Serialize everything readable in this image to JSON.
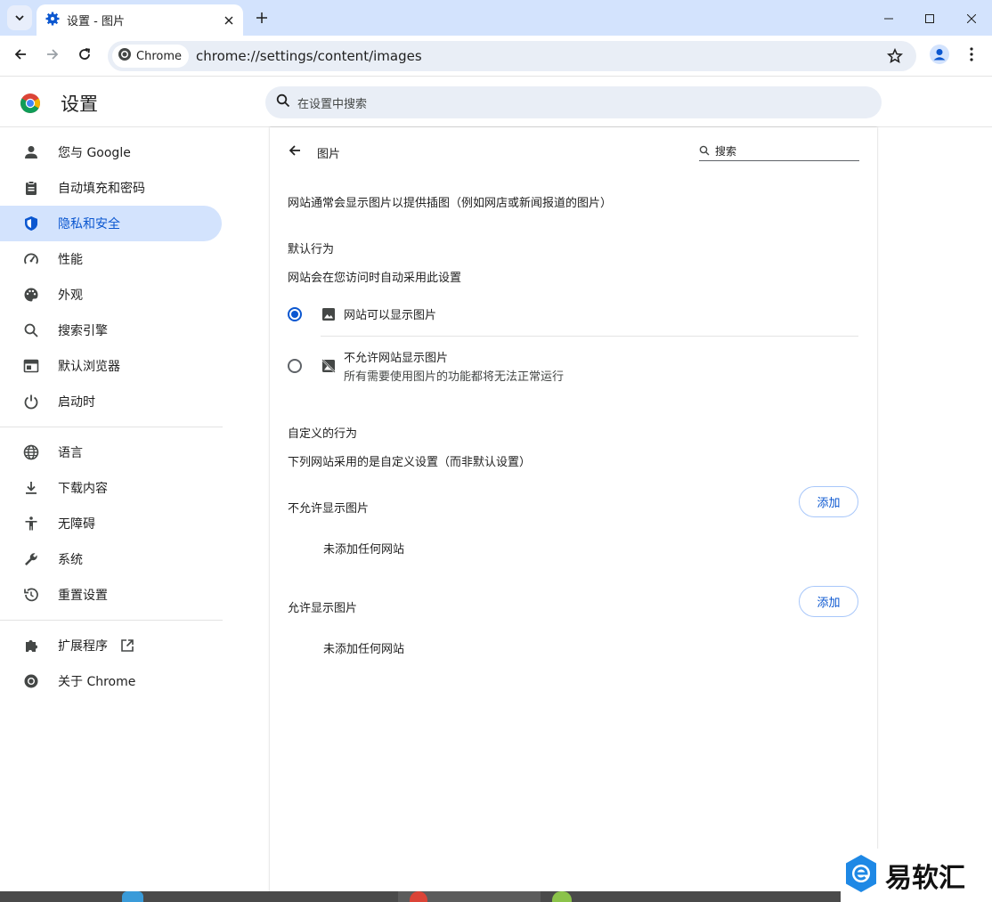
{
  "tab": {
    "title": "设置 - 图片"
  },
  "omnibox": {
    "chip_label": "Chrome",
    "url": "chrome://settings/content/images"
  },
  "header": {
    "title": "设置",
    "search_placeholder": "在设置中搜索"
  },
  "sidebar": {
    "items": [
      {
        "label": "您与 Google",
        "icon": "person-icon"
      },
      {
        "label": "自动填充和密码",
        "icon": "clipboard-icon"
      },
      {
        "label": "隐私和安全",
        "icon": "shield-icon",
        "active": true
      },
      {
        "label": "性能",
        "icon": "speedometer-icon"
      },
      {
        "label": "外观",
        "icon": "palette-icon"
      },
      {
        "label": "搜索引擎",
        "icon": "search-icon"
      },
      {
        "label": "默认浏览器",
        "icon": "browser-icon"
      },
      {
        "label": "启动时",
        "icon": "power-icon"
      },
      {
        "label": "语言",
        "icon": "globe-icon"
      },
      {
        "label": "下载内容",
        "icon": "download-icon"
      },
      {
        "label": "无障碍",
        "icon": "accessibility-icon"
      },
      {
        "label": "系统",
        "icon": "wrench-icon"
      },
      {
        "label": "重置设置",
        "icon": "reset-icon"
      },
      {
        "label": "扩展程序",
        "icon": "puzzle-icon"
      },
      {
        "label": "关于 Chrome",
        "icon": "chrome-icon"
      }
    ]
  },
  "page": {
    "title": "图片",
    "search_placeholder": "搜索",
    "description": "网站通常会显示图片以提供插图（例如网店或新闻报道的图片）",
    "default_heading": "默认行为",
    "default_sub": "网站会在您访问时自动采用此设置",
    "options": [
      {
        "label": "网站可以显示图片",
        "sub": "",
        "selected": true,
        "icon": "image-icon"
      },
      {
        "label": "不允许网站显示图片",
        "sub": "所有需要使用图片的功能都将无法正常运行",
        "selected": false,
        "icon": "image-off-icon"
      }
    ],
    "custom_heading": "自定义的行为",
    "custom_sub": "下列网站采用的是自定义设置（而非默认设置）",
    "block_heading": "不允许显示图片",
    "allow_heading": "允许显示图片",
    "add_label": "添加",
    "empty_text": "未添加任何网站"
  },
  "watermark": {
    "text": "易软汇"
  },
  "colors": {
    "accent": "#0b57d0",
    "active_bg": "#d3e3fd",
    "titlebar": "#d3e3fd"
  }
}
